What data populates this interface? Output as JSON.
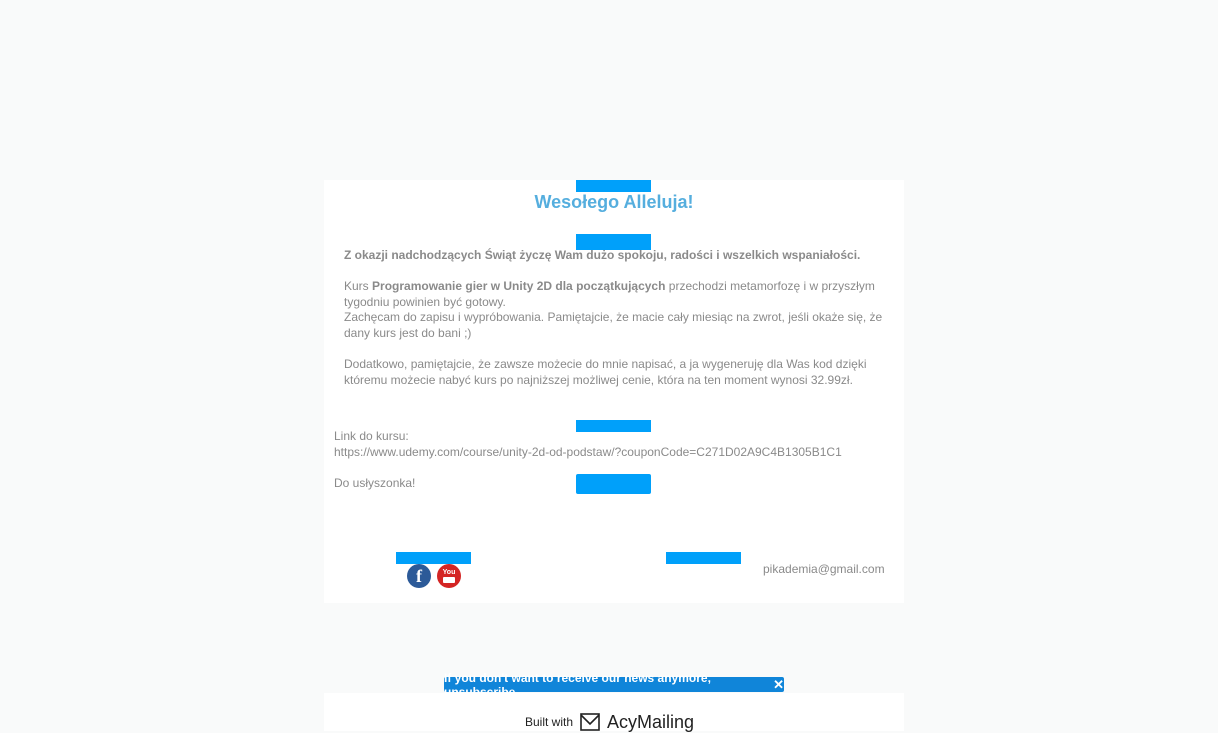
{
  "email": {
    "title": "Wesołego Alleluja!",
    "greeting": "Z okazji nadchodzących Świąt życzę Wam dużo spokoju, radości i wszelkich wspaniałości.",
    "p1_prefix": "Kurs ",
    "p1_course": "Programowanie gier w Unity 2D dla początkujących",
    "p1_line1_rest": " przechodzi metamorfozę i w przyszłym",
    "p1_line2": "tygodniu powinien być gotowy.",
    "p2_line1": "Zachęcam do zapisu i wypróbowania. Pamiętajcie, że macie cały miesiąc na zwrot, jeśli okaże się, że",
    "p2_line2": "dany kurs jest do bani ;)",
    "p3_line1": "Dodatkowo, pamiętajcie, że zawsze możecie do mnie napisać, a ja wygeneruję dla Was kod dzięki",
    "p3_line2": "któremu możecie nabyć kurs po najniższej możliwej cenie, która na ten moment wynosi 32.99zł.",
    "link_label": "Link do kursu:",
    "link_url": "https://www.udemy.com/course/unity-2d-od-podstaw/?couponCode=C271D02A9C4B1305B1C1",
    "signoff": "Do usłyszonka!",
    "contact_email": "pikademia@gmail.com"
  },
  "social": {
    "facebook_icon": "facebook-icon",
    "youtube_icon": "youtube-icon",
    "facebook_glyph": "f",
    "youtube_glyph": "You"
  },
  "footer": {
    "unsubscribe_text": "If you don't want to receive our news anymore, unsubscribe",
    "close_glyph": "✕",
    "built_with": "Built with",
    "brand": "AcyMailing"
  },
  "colors": {
    "title": "#55aede",
    "placeholder_bar": "#00a0fa",
    "unsubscribe_bg": "#1085d9"
  }
}
